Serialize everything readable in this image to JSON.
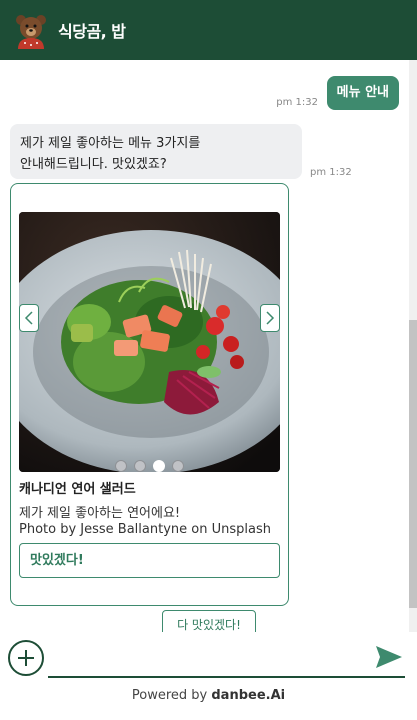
{
  "header": {
    "title": "식당곰, 밥"
  },
  "messages": {
    "user": {
      "text": "메뉴 안내",
      "time": "pm 1:32"
    },
    "bot": {
      "line1": "제가 제일 좋아하는 메뉴 3가지를",
      "line2": "안내해드립니다. 맛있겠죠?",
      "time": "pm 1:32"
    }
  },
  "card": {
    "title": "캐나디언 연어 샐러드",
    "desc1": "제가 제일 좋아하는 연어에요!",
    "desc2": "Photo by Jesse Ballantyne on Unsplash",
    "button": "맛있겠다!",
    "carousel": {
      "total": 4,
      "active_index": 2
    }
  },
  "quick_reply": "다 맛있겠다!",
  "powered": {
    "prefix": "Powered by ",
    "brand": "danbee.Ai"
  },
  "colors": {
    "header": "#1d4d36",
    "accent": "#3e8a6e",
    "bot_bubble": "#eeeff1"
  },
  "icons": {
    "avatar": "bear-avatar-icon",
    "prev": "chevron-left-icon",
    "next": "chevron-right-icon",
    "plus": "plus-icon",
    "send": "send-icon"
  }
}
